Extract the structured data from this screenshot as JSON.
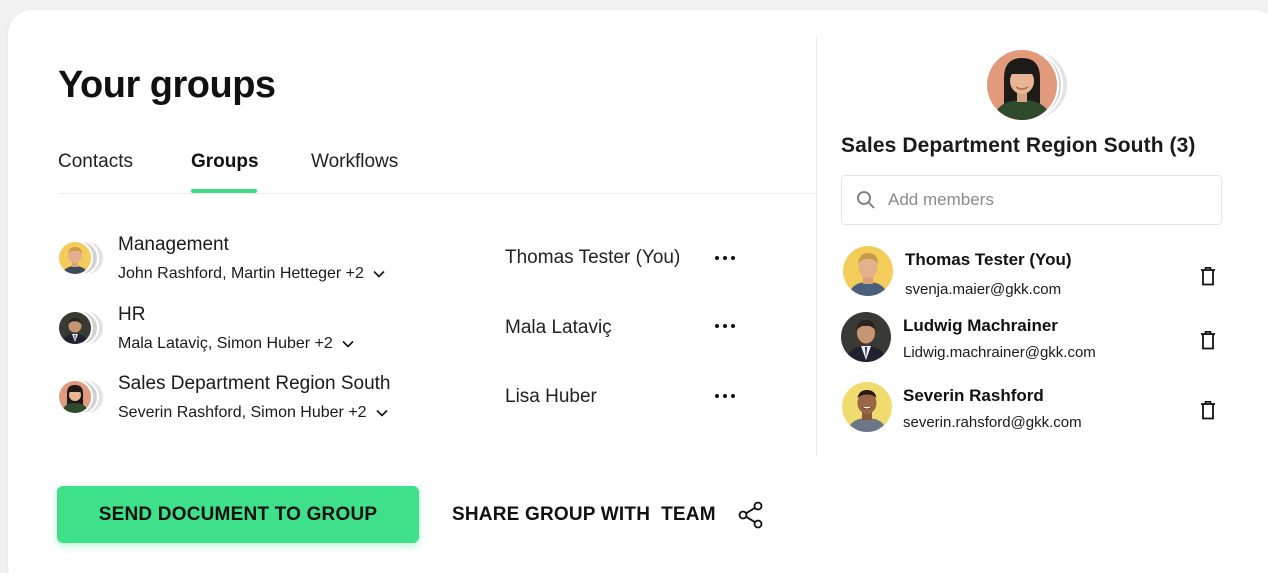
{
  "title": "Your groups",
  "tabs": [
    {
      "label": "Contacts",
      "active": false
    },
    {
      "label": "Groups",
      "active": true
    },
    {
      "label": "Workflows",
      "active": false
    }
  ],
  "groups": [
    {
      "name": "Management",
      "members": "John Rashford, Martin Hetteger +2",
      "owner": "Thomas Tester (You)",
      "avatar": "blond-man-avatar"
    },
    {
      "name": "HR",
      "members": "Mala Lataviç, Simon Huber +2",
      "owner": "Mala Lataviç",
      "avatar": "man-in-suit-avatar"
    },
    {
      "name": "Sales Department Region South",
      "members": "Severin Rashford, Simon Huber +2",
      "owner": "Lisa Huber",
      "avatar": "woman-dark-hair-avatar"
    }
  ],
  "actions": {
    "send_label": "SEND DOCUMENT TO GROUP",
    "share_label": "SHARE GROUP WITH  TEAM"
  },
  "detail": {
    "group_title": "Sales Department Region South (3)",
    "search_placeholder": "Add members",
    "members": [
      {
        "name": "Thomas Tester (You)",
        "email": "svenja.maier@gkk.com",
        "avatar": "blond-man-avatar"
      },
      {
        "name": "Ludwig Machrainer",
        "email": "Lidwig.machrainer@gkk.com",
        "avatar": "man-in-suit-avatar"
      },
      {
        "name": "Severin Rashford",
        "email": "severin.rahsford@gkk.com",
        "avatar": "smiling-man-avatar"
      }
    ]
  },
  "colors": {
    "accent": "#3ee08a",
    "yellow_avatar_bg": "#f4cc5a",
    "salmon_avatar_bg": "#e29a7c",
    "dark_avatar_bg": "#3a3a34"
  }
}
